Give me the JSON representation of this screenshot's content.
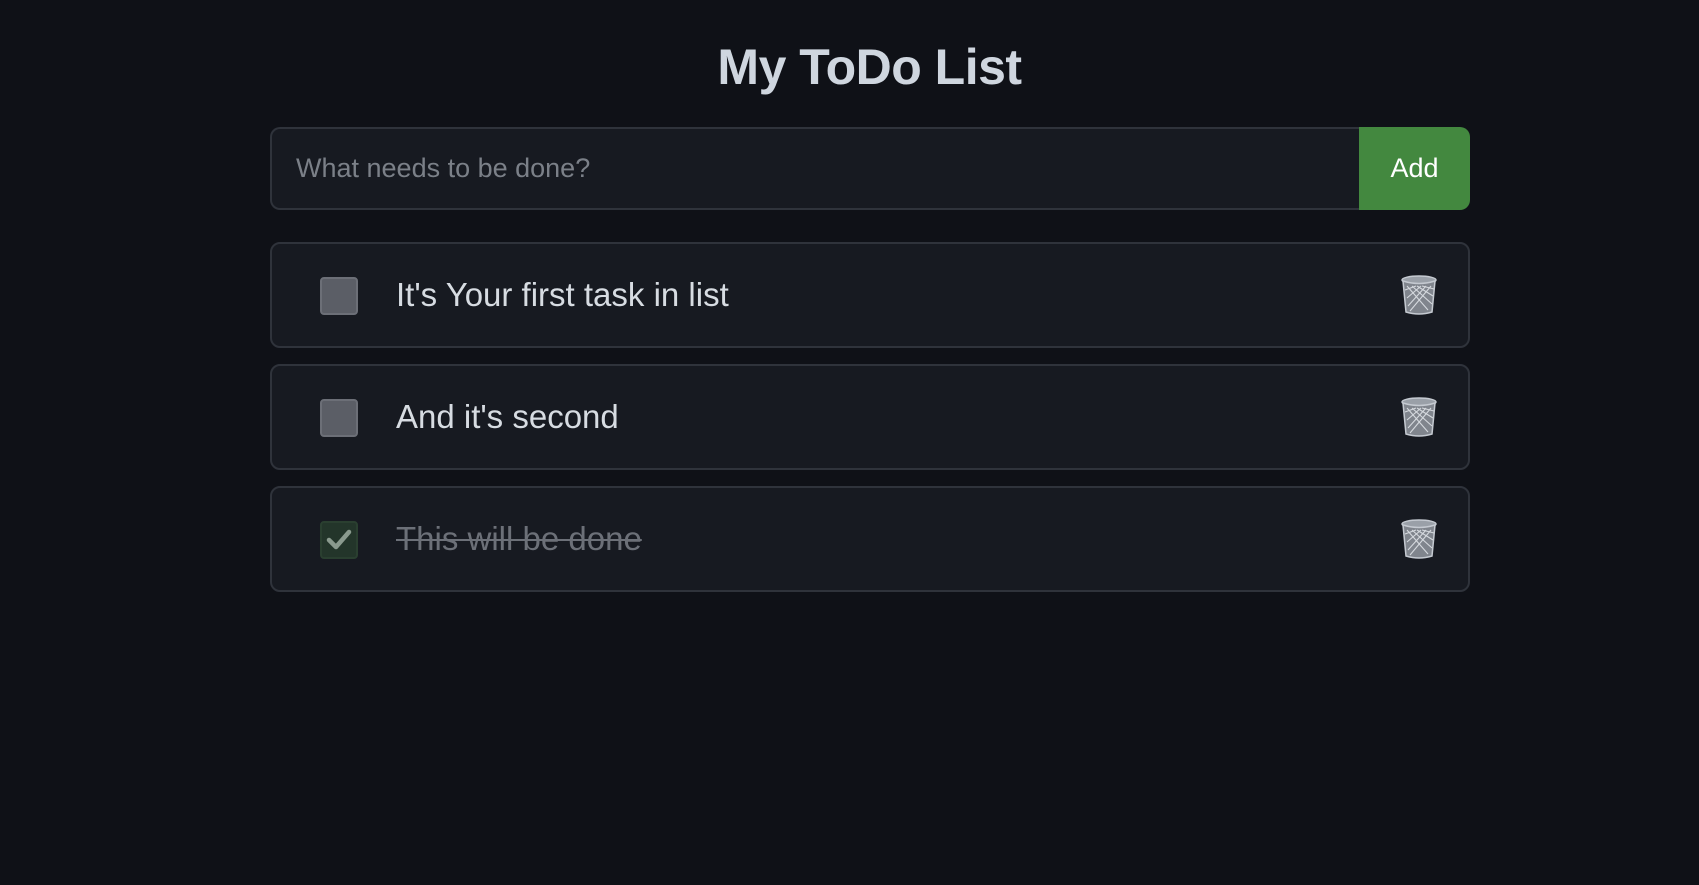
{
  "title": "My ToDo List",
  "input": {
    "placeholder": "What needs to be done?",
    "value": ""
  },
  "add_button_label": "Add",
  "colors": {
    "background": "#0f1117",
    "accent": "#43883f"
  },
  "tasks": [
    {
      "text": "It's Your first task in list",
      "done": false
    },
    {
      "text": "And it's second",
      "done": false
    },
    {
      "text": "This will be done",
      "done": true
    }
  ]
}
